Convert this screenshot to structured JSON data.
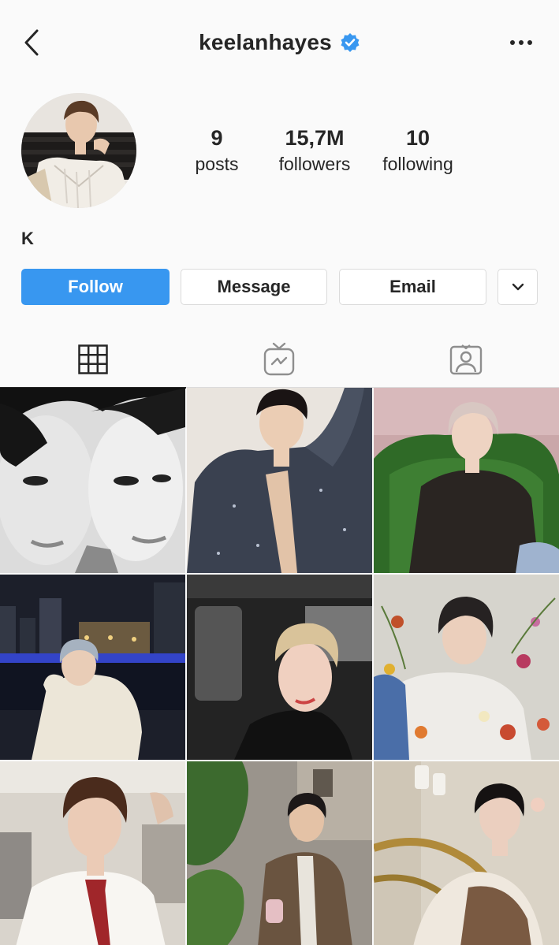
{
  "header": {
    "username": "keelanhayes",
    "verified": true,
    "back_icon": "chevron-left-icon",
    "more_icon": "more-horizontal-icon"
  },
  "profile": {
    "stats": [
      {
        "value": "9",
        "label": "posts"
      },
      {
        "value": "15,7M",
        "label": "followers"
      },
      {
        "value": "10",
        "label": "following"
      }
    ],
    "bio": "K"
  },
  "actions": {
    "follow": "Follow",
    "message": "Message",
    "email": "Email",
    "dropdown_icon": "chevron-down-icon"
  },
  "tabs": [
    {
      "name": "grid",
      "icon": "grid-icon",
      "active": true
    },
    {
      "name": "igtv",
      "icon": "tv-icon",
      "active": false
    },
    {
      "name": "tagged",
      "icon": "tagged-person-icon",
      "active": false
    }
  ],
  "colors": {
    "accent": "#3897f0",
    "verified": "#3897f0",
    "text": "#262626",
    "border": "#dbdbdb",
    "background": "#fafafa"
  },
  "posts": [
    {
      "description": "black and white close-up of two faces"
    },
    {
      "description": "person in sparkly dark cardigan lying on white sheets"
    },
    {
      "description": "person in dark suit on green velvet chair"
    },
    {
      "description": "person in cream knit sweater by river at night"
    },
    {
      "description": "person with blonde hair in car interior"
    },
    {
      "description": "person with dark hair among flowers"
    },
    {
      "description": "person in white shirt and red tie in backstage room"
    },
    {
      "description": "person in tweed blazer outdoors with trees"
    },
    {
      "description": "person holding coat near brass railing"
    }
  ]
}
